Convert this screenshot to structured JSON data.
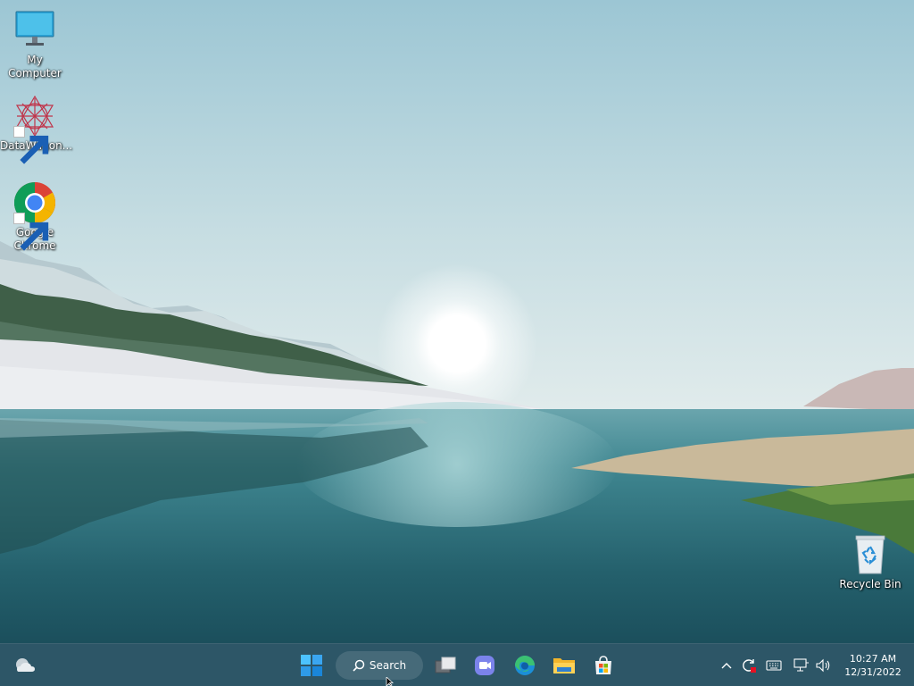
{
  "desktop": {
    "icons": [
      {
        "label": "My Computer",
        "icon": "monitor-icon"
      },
      {
        "label": "DataWagon...",
        "icon": "datawagon-icon",
        "shortcut": true
      },
      {
        "label": "Google Chrome",
        "icon": "chrome-icon",
        "shortcut": true
      },
      {
        "label": "Recycle Bin",
        "icon": "recycle-bin-icon"
      }
    ]
  },
  "taskbar": {
    "search_label": "Search",
    "pinned": [
      "start-icon",
      "search-icon",
      "task-view-icon",
      "teams-chat-icon",
      "edge-icon",
      "file-explorer-icon",
      "microsoft-store-icon"
    ],
    "tray": [
      "show-hidden-icons-chevron",
      "sync-status-icon",
      "keyboard-icon",
      "network-icon",
      "volume-icon"
    ],
    "clock": {
      "time": "10:27 AM",
      "date": "12/31/2022"
    }
  },
  "colors": {
    "taskbar": "#1e4658",
    "accent": "#0078d4"
  }
}
